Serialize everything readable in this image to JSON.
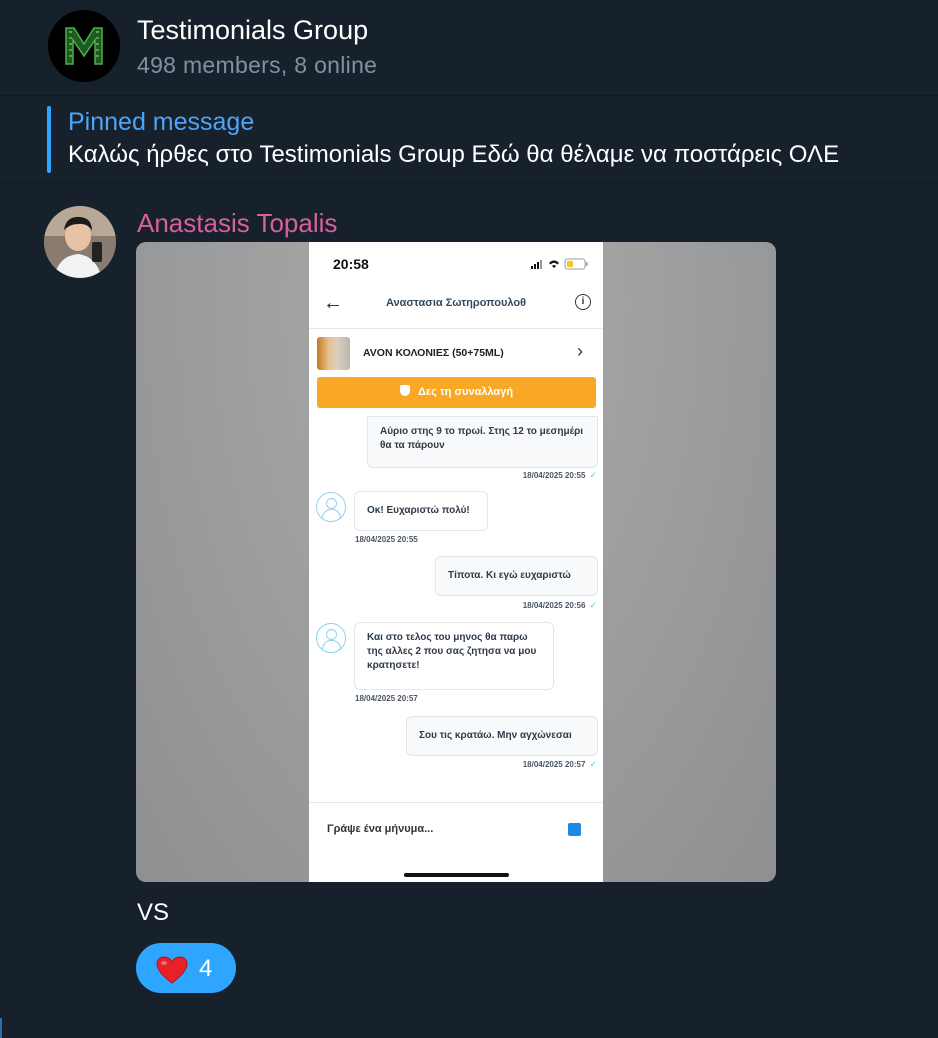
{
  "chat": {
    "title": "Testimonials Group",
    "subtitle": "498 members, 8 online",
    "avatar_letter": "M"
  },
  "pinned": {
    "label": "Pinned message",
    "text": "Καλώς ήρθες στο Testimonials Group  Εδώ θα θέλαμε να ποστάρεις ΟΛΕ"
  },
  "message": {
    "sender": "Anastasis Topalis",
    "caption": "VS",
    "reaction": {
      "emoji": "heart-icon",
      "count": "4"
    }
  },
  "screenshot": {
    "time": "20:58",
    "contact_name": "Αναστασια Σωτηροπουλοθ",
    "product": "AVON ΚΟΛΟΝΙΕΣ (50+75ML)",
    "deal_button": "Δες τη συναλλαγή",
    "input_placeholder": "Γράψε ένα μήνυμα...",
    "messages": [
      {
        "dir": "out",
        "text": "Αύριο στης 9 το πρωί. Στης 12 το μεσημέρι θα τα πάρουν",
        "time": "18/04/2025 20:55"
      },
      {
        "dir": "in",
        "text": "Οκ! Ευχαριστώ πολύ!",
        "time": "18/04/2025 20:55"
      },
      {
        "dir": "out",
        "text": "Τίποτα. Κι εγώ ευχαριστώ",
        "time": "18/04/2025 20:56"
      },
      {
        "dir": "in",
        "text": "Και στο τελος του μηνος θα παρω της αλλες 2 που σας ζητησα να μου κρατησετε!",
        "time": "18/04/2025 20:57"
      },
      {
        "dir": "out",
        "text": "Σου τις κρατάω. Μην αγχώνεσαι",
        "time": "18/04/2025 20:57"
      }
    ]
  },
  "colors": {
    "background": "#17212b",
    "accent": "#2ea6ff",
    "sender_name": "#d7609e",
    "deal_button": "#f9a825"
  }
}
